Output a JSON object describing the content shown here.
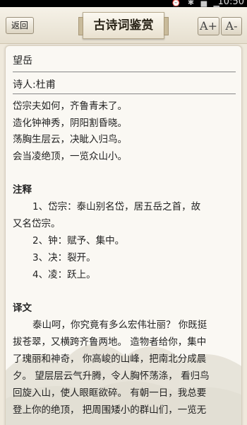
{
  "status_bar": {
    "time": "10:50",
    "icons": "⏰ ✱ ▅ ▁"
  },
  "header": {
    "back_label": "返回",
    "title": "古诗词鉴赏",
    "font_up_label": "A+",
    "font_down_label": "A-"
  },
  "poem": {
    "title": "望岳",
    "author": "诗人:杜甫",
    "lines": [
      "岱宗夫如何，齐鲁青未了。",
      "造化钟神秀，阴阳割昏晓。",
      "荡胸生层云，决眦入归鸟。",
      "会当凌绝顶，一览众山小。"
    ]
  },
  "notes": {
    "heading": "注释",
    "items": [
      "1、岱宗：泰山别名岱，居五岳之首，故",
      "又名岱宗。",
      "2、钟：赋予、集中。",
      "3、决：裂开。",
      "4、凌：跃上。"
    ]
  },
  "translation": {
    "heading": "译文",
    "lines": [
      "泰山呵，你究竟有多么宏伟壮丽？ 你既挺",
      "拔苍翠，又横跨齐鲁两地。 造物者给你，集中",
      "了瑰丽和神奇， 你高峻的山峰，把南北分成晨",
      "夕。 望层层云气升腾，令人胸怀荡涤， 看归鸟",
      "回旋入山，使人眼眶欲碎。 有朝一日，我总要",
      "登上你的绝顶， 把周围矮小的群山们，一览无"
    ]
  }
}
